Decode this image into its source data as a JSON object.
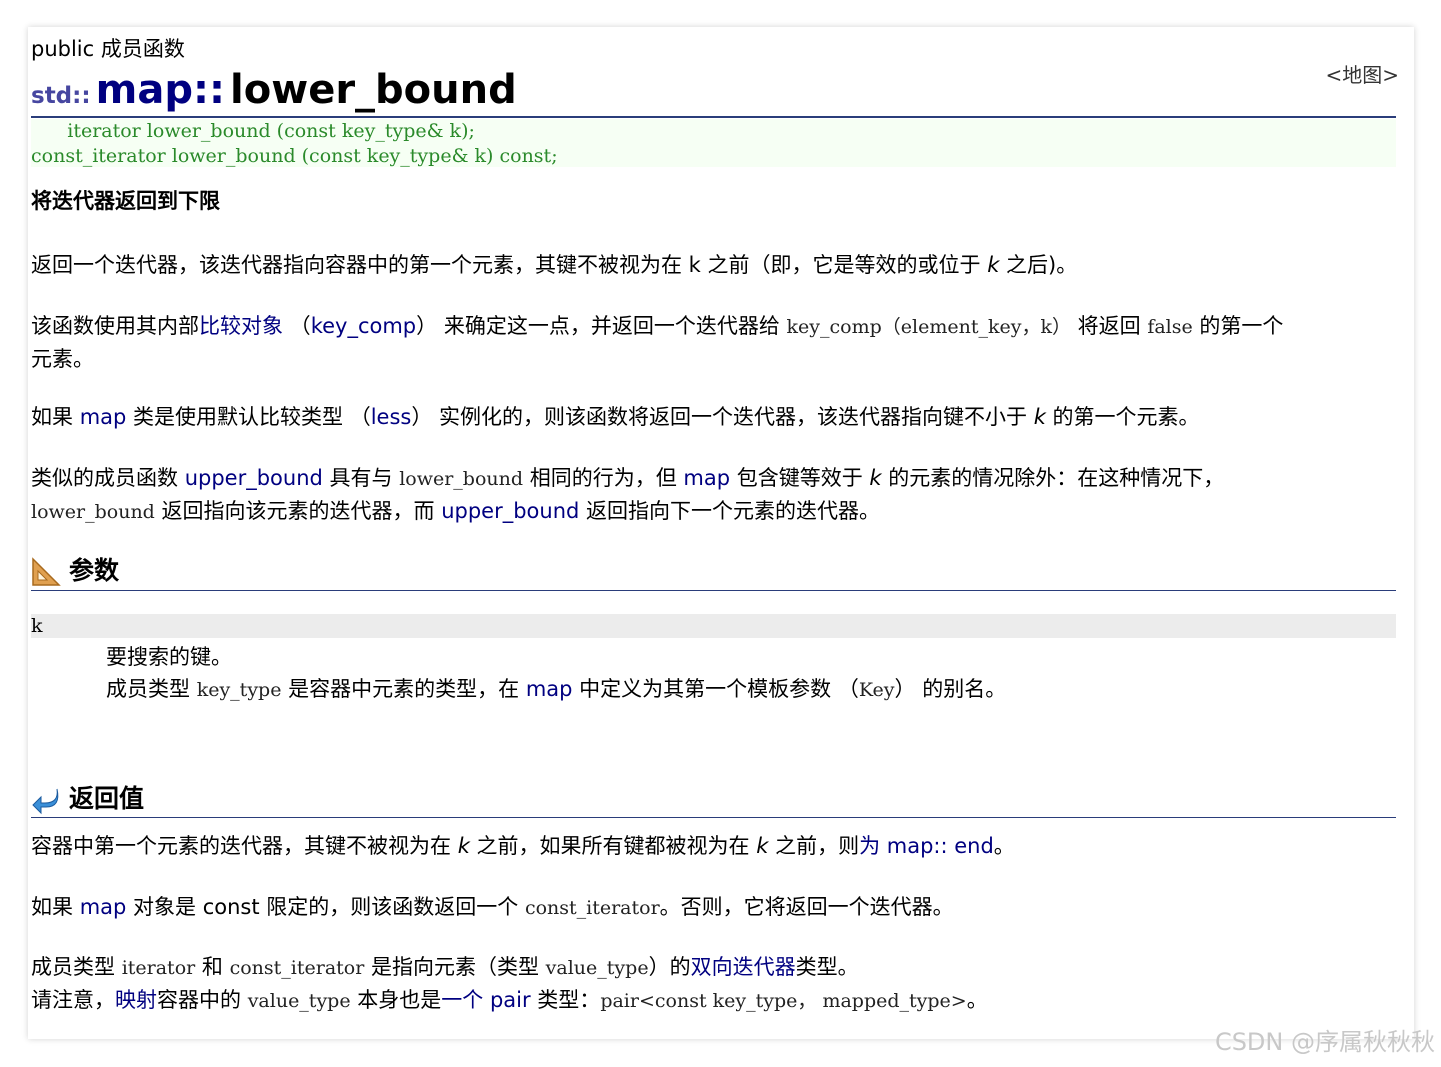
{
  "header": {
    "kind": "public 成员函数",
    "map_link": "<地图>",
    "ns": "std::",
    "cls": "map",
    "sep": "::",
    "fn": "lower_bound"
  },
  "prototypes": [
    "      iterator lower_bound (const key_type& k);",
    "const_iterator lower_bound (const key_type& k) const;"
  ],
  "subtitle": "将迭代器返回到下限",
  "desc": {
    "p1_a": "返回一个迭代器，该迭代器指向容器中的第一个元素，其键不被视为在 k 之前（即，它是等效的或位于 ",
    "p1_k": "k",
    "p1_b": " 之后)。",
    "p2_a": "该函数使用其内部",
    "p2_link": "比较对象",
    "p2_b": " （",
    "p2_kc": "key_comp",
    "p2_c": "） 来确定这一点，并返回一个迭代器给 ",
    "p2_code1": "key_comp（element_key，k）",
    "p2_d": " 将返回 ",
    "p2_code2": "false",
    "p2_e": " 的第一个",
    "p2_f": "元素。",
    "p3_a": "如果 ",
    "p3_map": "map",
    "p3_b": " 类是使用默认比较类型 （",
    "p3_less": "less",
    "p3_c": "） 实例化的，则该函数将返回一个迭代器，该迭代器指向键不小于 ",
    "p3_k": "k",
    "p3_d": " 的第一个元素。",
    "p4_a": "类似的成员函数 ",
    "p4_ub": "upper_bound",
    "p4_b": " 具有与 ",
    "p4_lb": "lower_bound",
    "p4_c": " 相同的行为，但 ",
    "p4_map": "map",
    "p4_d": " 包含键等效于 ",
    "p4_k": "k",
    "p4_e": " 的元素的情况除外：在这种情况下，",
    "p4_lb2": "lower_bound",
    "p4_f": " 返回指向该元素的迭代器，而 ",
    "p4_ub2": "upper_bound",
    "p4_g": " 返回指向下一个元素的迭代器。"
  },
  "params": {
    "heading": "参数",
    "term": "k",
    "d1": "要搜索的键。",
    "d2_a": "成员类型 ",
    "d2_code": "key_type",
    "d2_b": " 是容器中元素的类型，在 ",
    "d2_map": "map",
    "d2_c": " 中定义为其第一个模板参数 （",
    "d2_key": "Key",
    "d2_d": "） 的别名。"
  },
  "ret": {
    "heading": "返回值",
    "r1_a": "容器中第一个元素的迭代器，其键不被视为在 ",
    "r1_k": "k",
    "r1_b": " 之前，如果所有键都被视为在 ",
    "r1_k2": "k",
    "r1_c": " 之前，则",
    "r1_link": "为 map:: end",
    "r1_d": "。",
    "r2_a": "如果 ",
    "r2_map": "map",
    "r2_b": " 对象是 const 限定的，则该函数返回一个 ",
    "r2_code": "const_iterator",
    "r2_c": "。否则，它将返回一个迭代器。",
    "r3_a": "成员类型 ",
    "r3_code1": "iterator",
    "r3_b": " 和 ",
    "r3_code2": "const_iterator",
    "r3_c": " 是指向元素（类型 ",
    "r3_code3": "value_type",
    "r3_d": "）的",
    "r3_link": "双向迭代器",
    "r3_e": "类型。",
    "r4_a": "请注意，",
    "r4_link": "映射",
    "r4_b": "容器中的 ",
    "r4_code1": "value_type",
    "r4_c": " 本身也是",
    "r4_link2": "一个 pair",
    "r4_d": " 类型：",
    "r4_code2": "pair",
    "r4_code3": "<const key_type， mapped_type>",
    "r4_e": "。"
  },
  "watermark": "CSDN @序属秋秋秋",
  "colors": {
    "link": "#000080",
    "rule": "#2a3d7a",
    "proto_bg": "#f6fff4",
    "proto_text": "#2a8a2a"
  }
}
